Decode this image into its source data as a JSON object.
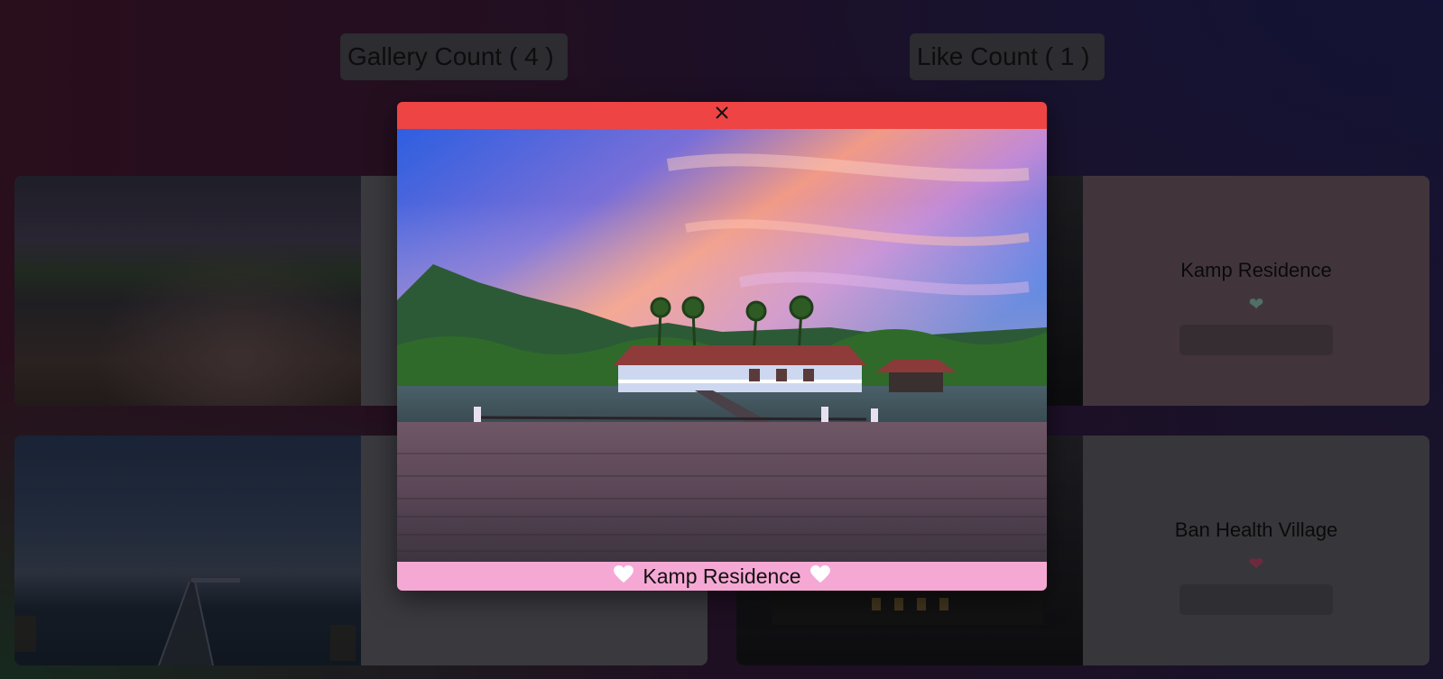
{
  "counters": {
    "gallery_label": "Gallery Count ( 4 )",
    "like_label": "Like Count ( 1 )"
  },
  "gallery": {
    "items": [
      {
        "title": ""
      },
      {
        "title": "Kamp Residence"
      },
      {
        "title": ""
      },
      {
        "title": "Ban Health Village"
      }
    ]
  },
  "modal": {
    "close_icon": "close-icon",
    "caption": "Kamp Residence",
    "heart_icon": "heart-icon",
    "header_color": "#ee4444",
    "footer_color": "#f6a8d4"
  }
}
